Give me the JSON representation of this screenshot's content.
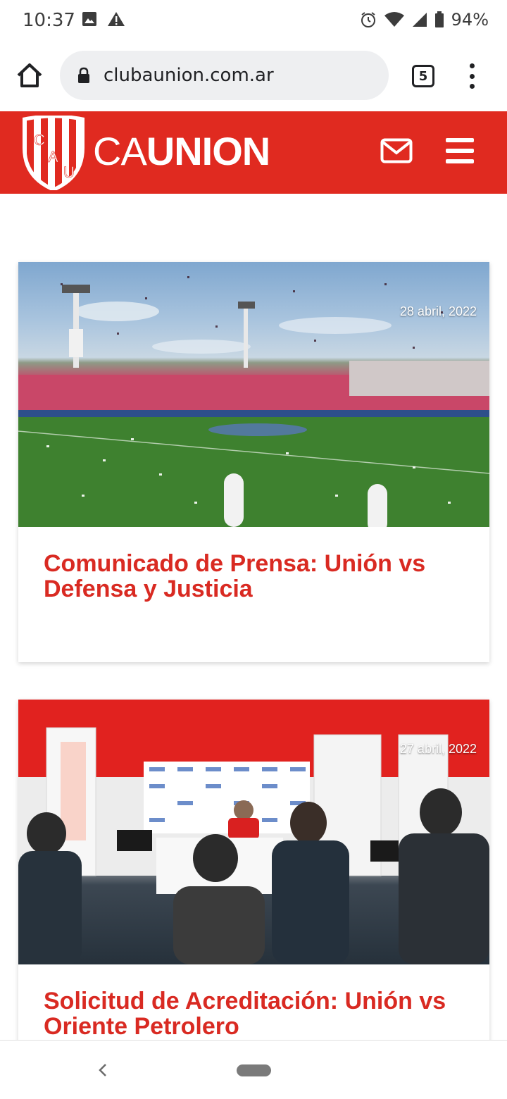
{
  "status_bar": {
    "time": "10:37",
    "battery": "94%"
  },
  "browser": {
    "url": "clubaunion.com.ar",
    "tab_count": "5"
  },
  "site": {
    "logo_ca": "CA",
    "logo_union": "UNION",
    "shield_letters": [
      "C",
      "A",
      "U"
    ],
    "brand_color": "#e02a20",
    "title_color": "#d92a22"
  },
  "articles": [
    {
      "date": "28 abril, 2022",
      "title": "Comunicado de Prensa: Unión vs Defensa y Justicia"
    },
    {
      "date": "27 abril, 2022",
      "title": "Solicitud de Acreditación: Unión vs Oriente Petrolero"
    }
  ]
}
